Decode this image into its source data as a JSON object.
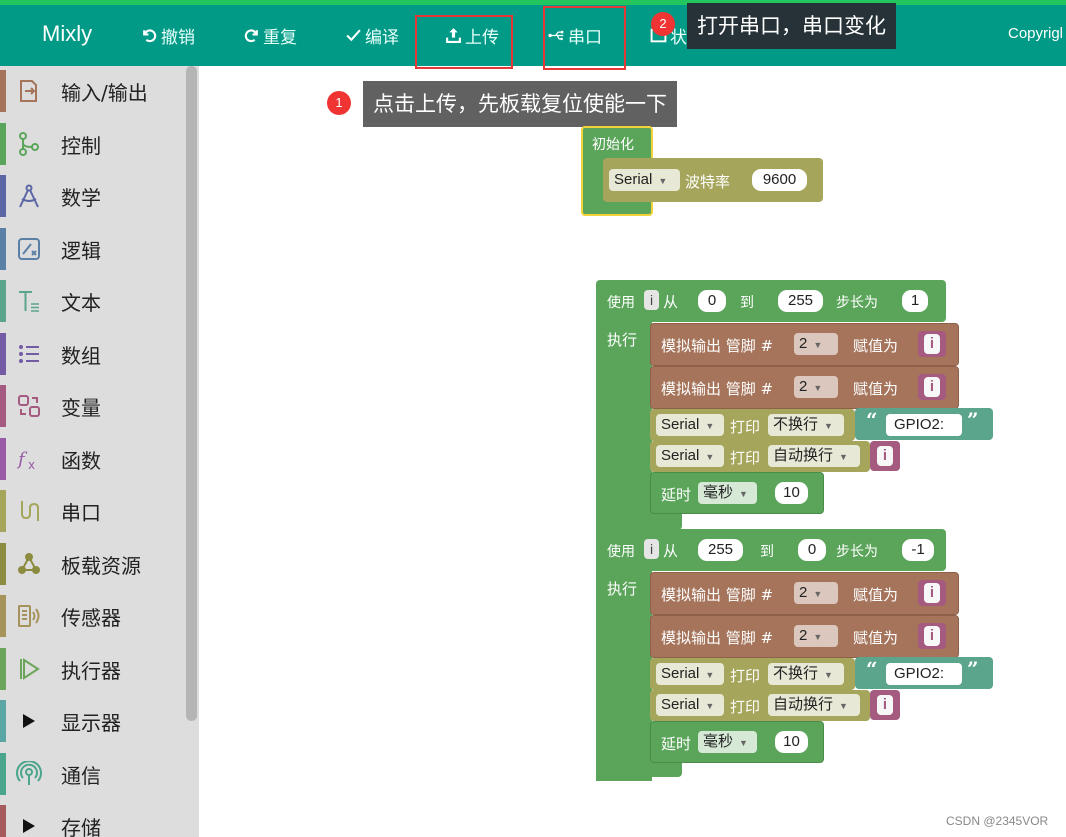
{
  "app": {
    "brand": "Mixly",
    "copyright": "Copyrigl"
  },
  "toolbar": {
    "undo": "撤销",
    "redo": "重复",
    "compile": "编译",
    "upload": "上传",
    "serial": "串口",
    "status_partial": "状"
  },
  "callouts": [
    {
      "number": "1",
      "text": "点击上传，先板载复位使能一下"
    },
    {
      "number": "2",
      "text": "打开串口，串口变化"
    }
  ],
  "sidebar": {
    "categories": [
      {
        "label": "输入/输出",
        "icon": "io-icon",
        "color": "#a5745b"
      },
      {
        "label": "控制",
        "icon": "control-icon",
        "color": "#5ba55b"
      },
      {
        "label": "数学",
        "icon": "math-icon",
        "color": "#5b67a5"
      },
      {
        "label": "逻辑",
        "icon": "logic-icon",
        "color": "#5b80a5"
      },
      {
        "label": "文本",
        "icon": "text-icon",
        "color": "#5ba58c"
      },
      {
        "label": "数组",
        "icon": "array-icon",
        "color": "#745ba5"
      },
      {
        "label": "变量",
        "icon": "variable-icon",
        "color": "#a55b80"
      },
      {
        "label": "函数",
        "icon": "function-icon",
        "color": "#995ba5"
      },
      {
        "label": "串口",
        "icon": "serial-icon",
        "color": "#a5a55b"
      },
      {
        "label": "板载资源",
        "icon": "board-icon",
        "color": "#8c8c40"
      },
      {
        "label": "传感器",
        "icon": "sensor-icon",
        "color": "#a5935b"
      },
      {
        "label": "执行器",
        "icon": "actuator-icon",
        "color": "#6aa55b"
      },
      {
        "label": "显示器",
        "icon": "expand-icon",
        "color": "#5ba5a5"
      },
      {
        "label": "通信",
        "icon": "communication-icon",
        "color": "#4aa58c"
      },
      {
        "label": "存储",
        "icon": "expand-icon",
        "color": "#a55b5b"
      }
    ]
  },
  "workspace": {
    "setup": {
      "title": "初始化",
      "serial_dropdown": "Serial",
      "baud_label": "波特率",
      "baud_value": "9600"
    },
    "loops": [
      {
        "use_label": "使用",
        "var": "i",
        "from_label": "从",
        "from": "0",
        "to_label": "到",
        "to": "255",
        "step_label": "步长为",
        "step": "1",
        "do_label": "执行",
        "analog_label": "模拟输出 管脚 #",
        "pin": "2",
        "assign_label": "赋值为",
        "value_var": "i",
        "serial": "Serial",
        "print_label": "打印",
        "no_newline": "不换行",
        "text": "GPIO2:",
        "newline": "自动换行",
        "delay_label": "延时",
        "delay_unit": "毫秒",
        "delay_value": "10"
      },
      {
        "use_label": "使用",
        "var": "i",
        "from_label": "从",
        "from": "255",
        "to_label": "到",
        "to": "0",
        "step_label": "步长为",
        "step": "-1",
        "do_label": "执行",
        "analog_label": "模拟输出 管脚 #",
        "pin": "2",
        "assign_label": "赋值为",
        "value_var": "i",
        "serial": "Serial",
        "print_label": "打印",
        "no_newline": "不换行",
        "text": "GPIO2:",
        "newline": "自动换行",
        "delay_label": "延时",
        "delay_unit": "毫秒",
        "delay_value": "10"
      }
    ]
  },
  "watermark": "CSDN @2345VOR"
}
